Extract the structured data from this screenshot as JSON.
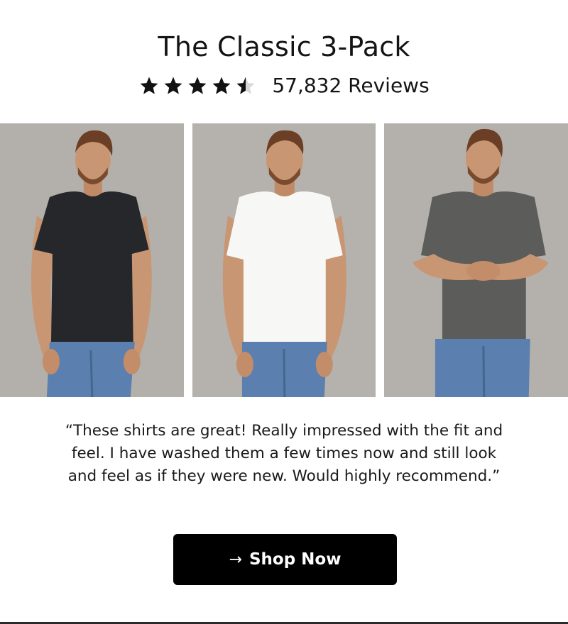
{
  "product": {
    "title": "The Classic 3-Pack",
    "rating": 4.5,
    "rating_max": 5,
    "review_count_label": "57,832 Reviews"
  },
  "photos": [
    {
      "shirt_color": "#26272a",
      "description_icon": "model-black-tee"
    },
    {
      "shirt_color": "#f7f7f5",
      "description_icon": "model-white-tee"
    },
    {
      "shirt_color": "#5c5d5b",
      "description_icon": "model-gray-tee"
    }
  ],
  "testimonial": {
    "text": "“These shirts are great! Really impressed with the fit and feel. I have washed them a few times now and still look and feel as if they were new. Would highly recommend.”"
  },
  "cta": {
    "arrow_icon": "arrow-right-icon",
    "label": "Shop Now"
  },
  "colors": {
    "background": "#ffffff",
    "photo_backdrop": "#b5b2ad",
    "button": "#000000",
    "jeans": "#5b7fae",
    "skin": "#c99673",
    "hair": "#6b3f25"
  }
}
